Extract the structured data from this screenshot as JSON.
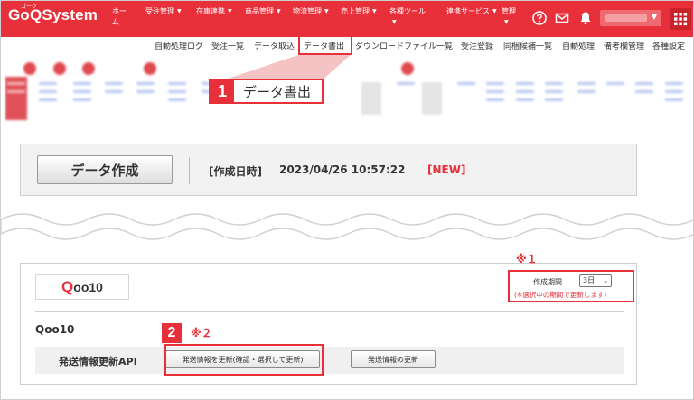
{
  "header": {
    "logo": "GoQSystem",
    "logo_ruby": "ゴーク",
    "nav": [
      {
        "label": "ホーム",
        "has_menu": false
      },
      {
        "label": "受注管理",
        "has_menu": true
      },
      {
        "label": "在庫連携",
        "has_menu": true
      },
      {
        "label": "商品管理",
        "has_menu": true
      },
      {
        "label": "物流管理",
        "has_menu": true
      },
      {
        "label": "売上管理",
        "has_menu": true
      },
      {
        "label": "各種ツール",
        "has_menu": true
      },
      {
        "label": "連携サービス",
        "has_menu": true
      },
      {
        "label": "管理",
        "has_menu": true
      }
    ],
    "icons": [
      "help-icon",
      "mail-icon",
      "bell-icon",
      "grid-menu-icon"
    ],
    "accent_color": "#e8303a"
  },
  "submenu": {
    "items": [
      "自動処理ログ",
      "受注一覧",
      "データ取込",
      "データ書出",
      "ダウンロードファイル一覧",
      "受注登録",
      "同梱候補一覧",
      "自動処理",
      "備考欄管理",
      "各種設定"
    ],
    "active": "データ書出"
  },
  "callout1": {
    "number": "1",
    "label": "データ書出"
  },
  "data_card": {
    "button": "データ作成",
    "datetime_label": "[作成日時]",
    "datetime_value": "2023/04/26 10:57:22",
    "new_badge": "[NEW]"
  },
  "qoo10": {
    "logo_q": "Q",
    "logo_rest": "oo10",
    "note1": "※１",
    "period_label": "作成期間",
    "period_value": "3日",
    "period_hint": "(※選択中の期間で更新します)",
    "shop_name": "Qoo10",
    "api_label": "発送情報更新API",
    "btn_confirm": "発送情報を更新(確認・選択して更新)",
    "btn_update": "発送情報の更新",
    "callout2_number": "2",
    "note2": "※２"
  }
}
